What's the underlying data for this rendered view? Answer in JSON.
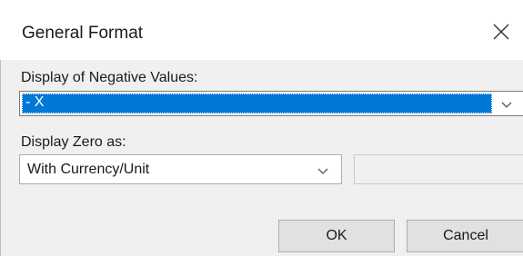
{
  "dialog": {
    "title": "General Format",
    "close_glyph": "✕"
  },
  "negative_values": {
    "label": "Display of Negative Values:",
    "selected": "- X",
    "highlight_color": "#0078d7",
    "dropdown_icon": "chevron-down-icon"
  },
  "zero": {
    "label": "Display Zero as:",
    "selected": "With Currency/Unit",
    "dropdown_icon": "chevron-down-icon",
    "text_value": ""
  },
  "buttons": {
    "ok": "OK",
    "cancel": "Cancel"
  }
}
